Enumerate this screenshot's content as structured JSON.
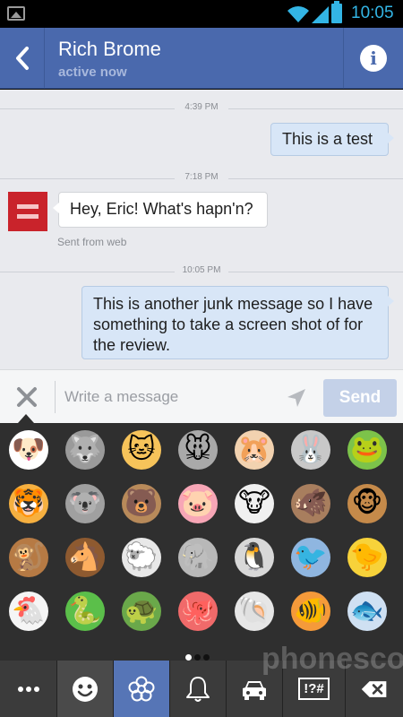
{
  "statusbar": {
    "time": "10:05"
  },
  "header": {
    "name": "Rich Brome",
    "status": "active now"
  },
  "thread": {
    "dividers": [
      "4:39 PM",
      "7:18 PM",
      "10:05 PM"
    ],
    "messages": [
      {
        "direction": "out",
        "text": "This is a test"
      },
      {
        "direction": "in",
        "text": "Hey, Eric! What's hapn'n?",
        "subtext": "Sent from web"
      },
      {
        "direction": "out",
        "text": "This is another junk message so I have something to take a screen shot of for the review."
      }
    ]
  },
  "composer": {
    "placeholder": "Write a message",
    "send_label": "Send"
  },
  "emoji": {
    "rows": [
      [
        "dog-face",
        "wolf-face",
        "cat-face",
        "mouse-face",
        "hamster-face",
        "rabbit-face",
        "frog-face"
      ],
      [
        "tiger-face",
        "koala-face",
        "bear-face",
        "pig-face",
        "cow-face",
        "boar-face",
        "monkey-face"
      ],
      [
        "monkey",
        "horse-face",
        "sheep",
        "elephant",
        "penguin",
        "bird",
        "baby-chick"
      ],
      [
        "chicken",
        "snake",
        "turtle",
        "octopus",
        "spiral-shell",
        "tropical-fish",
        "fish"
      ]
    ],
    "page_index": 0,
    "page_count": 3
  },
  "tabs": [
    {
      "name": "more",
      "icon": "ellipsis-icon"
    },
    {
      "name": "smileys",
      "icon": "smiley-icon"
    },
    {
      "name": "nature",
      "icon": "flower-icon",
      "active": true
    },
    {
      "name": "objects",
      "icon": "bell-icon"
    },
    {
      "name": "places",
      "icon": "car-icon"
    },
    {
      "name": "symbols",
      "label": "!?#"
    },
    {
      "name": "backspace",
      "icon": "backspace-icon"
    }
  ],
  "watermark": "phonescoop"
}
